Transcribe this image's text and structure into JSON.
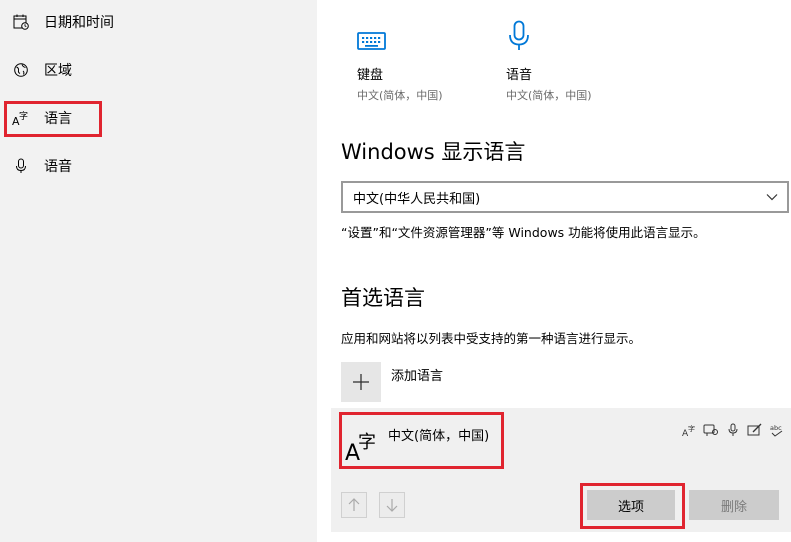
{
  "sidebar": {
    "items": [
      {
        "label": "日期和时间",
        "icon": "calendar-clock-icon"
      },
      {
        "label": "区域",
        "icon": "globe-region-icon"
      },
      {
        "label": "语言",
        "icon": "language-icon",
        "selected": true
      },
      {
        "label": "语音",
        "icon": "microphone-icon"
      }
    ]
  },
  "tiles": [
    {
      "title": "键盘",
      "subtitle": "中文(简体，中国)",
      "icon": "keyboard-icon"
    },
    {
      "title": "语音",
      "subtitle": "中文(简体，中国)",
      "icon": "microphone-icon"
    }
  ],
  "display_language": {
    "heading": "Windows 显示语言",
    "selected": "中文(中华人民共和国)",
    "note": "“设置”和“文件资源管理器”等 Windows 功能将使用此语言显示。"
  },
  "preferred": {
    "heading": "首选语言",
    "note": "应用和网站将以列表中受支持的第一种语言进行显示。",
    "add_label": "添加语言",
    "languages": [
      {
        "name": "中文(简体，中国)"
      }
    ],
    "options_label": "选项",
    "remove_label": "删除"
  },
  "colors": {
    "accent": "#0078d7",
    "highlight": "#e0242f",
    "sidebar_bg": "#f2f2f2"
  }
}
